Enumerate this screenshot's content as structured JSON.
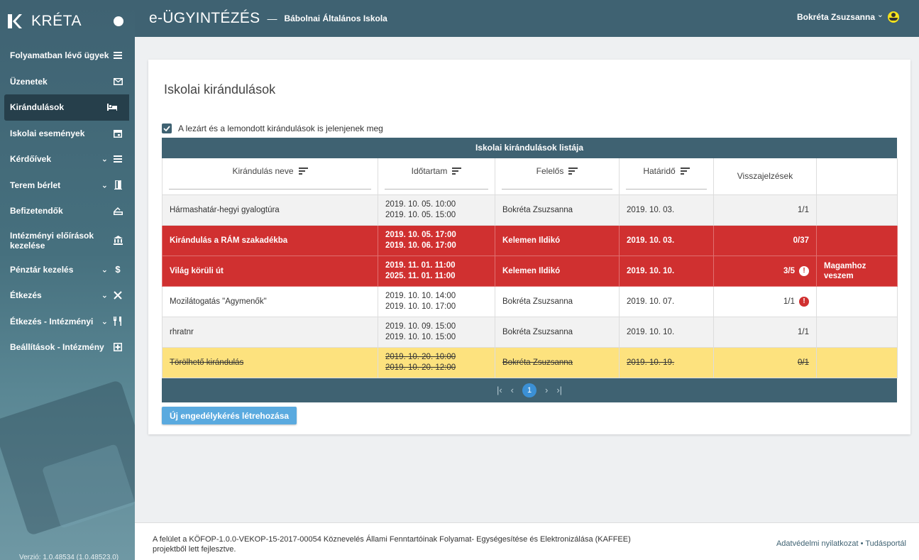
{
  "sidebar": {
    "brand": "KRÉTA",
    "items": [
      {
        "label": "Folyamatban lévő ügyek",
        "icon": "list-icon"
      },
      {
        "label": "Üzenetek",
        "icon": "mail-icon"
      },
      {
        "label": "Kirándulások",
        "icon": "bed-icon"
      },
      {
        "label": "Iskolai események",
        "icon": "calendar-icon"
      },
      {
        "label": "Kérdőívek",
        "icon": "list-icon"
      },
      {
        "label": "Terem bérlet",
        "icon": "door-icon"
      },
      {
        "label": "Befizetendők",
        "icon": "payment-icon"
      },
      {
        "label": "Intézményi előírások kezelése",
        "icon": "institution-icon"
      },
      {
        "label": "Pénztár kezelés",
        "icon": "dollar-icon"
      },
      {
        "label": "Étkezés",
        "icon": "cutlery-icon"
      },
      {
        "label": "Étkezés - Intézményi",
        "icon": "fork-knife-icon"
      },
      {
        "label": "Beállítások - Intézmény",
        "icon": "settings-box-icon"
      }
    ],
    "version": "Verzió: 1.0.48534 (1.0.48523.0)"
  },
  "topbar": {
    "app_title": "e-ÜGYINTÉZÉS",
    "separator": "—",
    "school": "Bábolnai Általános Iskola",
    "user": "Bokréta Zsuzsanna"
  },
  "page": {
    "title": "Iskolai kirándulások",
    "checkbox_label": "A lezárt és a lemondott kirándulások is jelenjenek meg",
    "table_caption": "Iskolai kirándulások listája",
    "columns": [
      "Kirándulás neve",
      "Időtartam",
      "Felelős",
      "Határidő",
      "Visszajelzések",
      ""
    ],
    "rows": [
      {
        "name": "Hármashatár-hegyi gyalogtúra",
        "start": "2019. 10. 05. 10:00",
        "end": "2019. 10. 05. 15:00",
        "owner": "Bokréta Zsuzsanna",
        "deadline": "2019. 10. 03.",
        "feedback": "1/1",
        "action": ""
      },
      {
        "name": "Kirándulás a RÁM szakadékba",
        "start": "2019. 10. 05. 17:00",
        "end": "2019. 10. 06. 17:00",
        "owner": "Kelemen Ildikó",
        "deadline": "2019. 10. 03.",
        "feedback": "0/37",
        "action": ""
      },
      {
        "name": "Világ körüli út",
        "start": "2019. 11. 01. 11:00",
        "end": "2025. 11. 01. 11:00",
        "owner": "Kelemen Ildikó",
        "deadline": "2019. 10. 10.",
        "feedback": "3/5",
        "action": "Magamhoz veszem"
      },
      {
        "name": "Mozilátogatás \"Agymenők\"",
        "start": "2019. 10. 10. 14:00",
        "end": "2019. 10. 10. 17:00",
        "owner": "Bokréta Zsuzsanna",
        "deadline": "2019. 10. 07.",
        "feedback": "1/1",
        "action": ""
      },
      {
        "name": "rhratnr",
        "start": "2019. 10. 09. 15:00",
        "end": "2019. 10. 10. 15:00",
        "owner": "Bokréta Zsuzsanna",
        "deadline": "2019. 10. 10.",
        "feedback": "1/1",
        "action": ""
      },
      {
        "name": "Törölhető kirándulás",
        "start": "2019. 10. 20. 10:00",
        "end": "2019. 10. 20. 12:00",
        "owner": "Bokréta Zsuzsanna",
        "deadline": "2019. 10. 19.",
        "feedback": "0/1",
        "action": ""
      }
    ],
    "pager": {
      "current": "1"
    },
    "new_button": "Új engedélykérés létrehozása",
    "warn_glyph": "!"
  },
  "footer": {
    "text": "A felület a KÖFOP-1.0.0-VEKOP-15-2017-00054 Köznevelés Állami Fenntartóinak Folyamat- Egységesítése és Elektronizálása (KAFFEE) projektből lett fejlesztve.",
    "link1": "Adatvédelmi nyilatkozat",
    "bullet": "•",
    "link2": "Tudásportál"
  },
  "colors": {
    "primary": "#3f6272",
    "danger": "#d03030",
    "warning": "#fde27e",
    "button": "#5aaadf"
  }
}
